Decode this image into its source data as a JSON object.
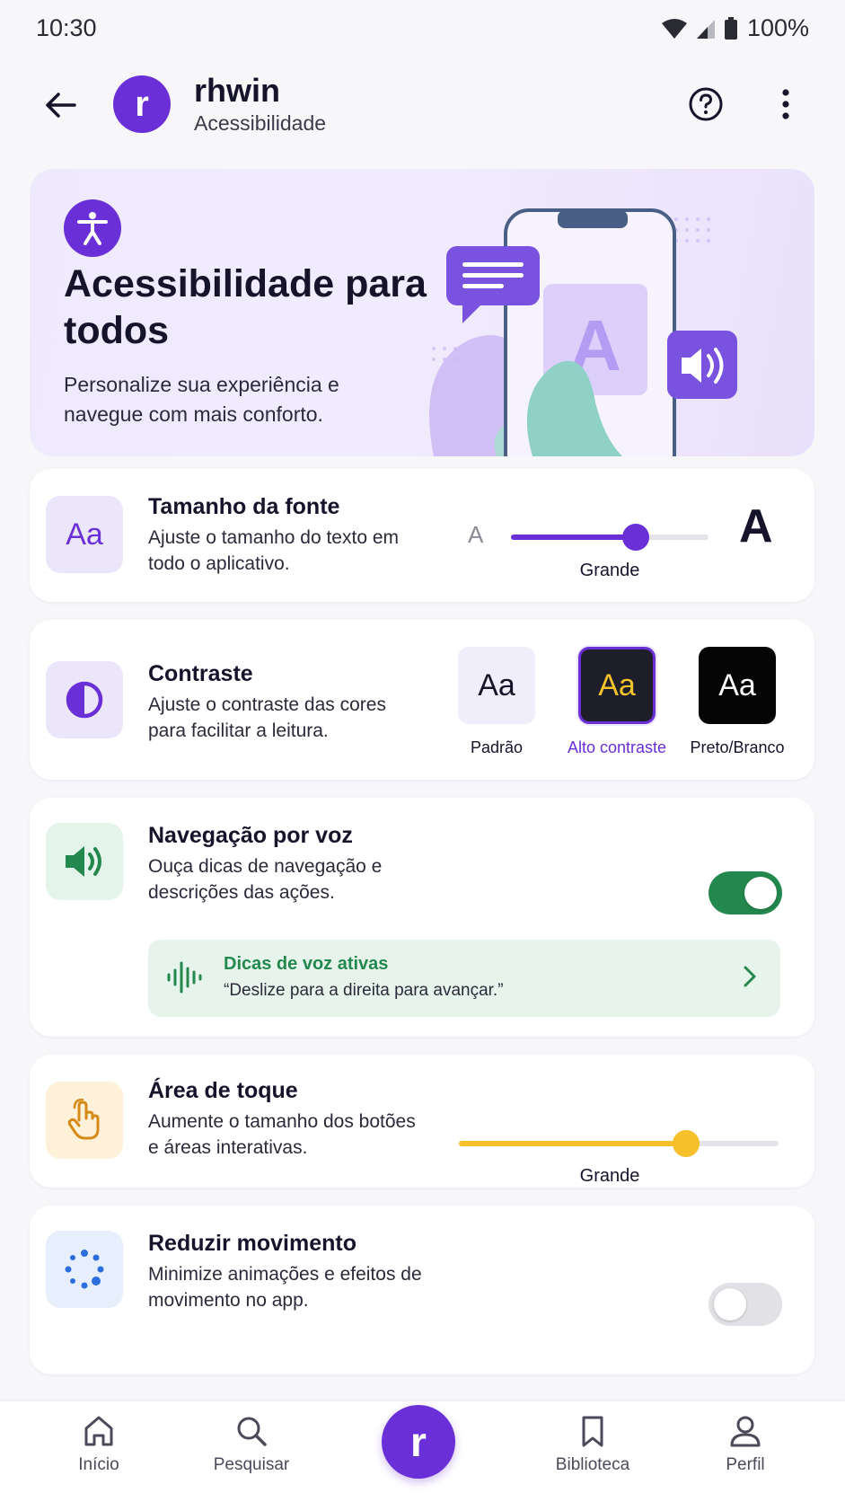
{
  "status_bar": {
    "time": "10:30",
    "battery": "100%"
  },
  "header": {
    "avatar_letter": "r",
    "title": "rhwin",
    "subtitle": "Acessibilidade"
  },
  "hero": {
    "title": "Acessibilidade para todos",
    "description": "Personalize sua experiência e navegue com mais conforto.",
    "illustration_letter": "A"
  },
  "font_size": {
    "title": "Tamanho da fonte",
    "description": "Ajuste o tamanho do texto em todo o aplicativo.",
    "icon_text": "Aa",
    "small_label": "A",
    "large_label": "A",
    "level": 0.63,
    "value_label": "Grande"
  },
  "contrast": {
    "title": "Contraste",
    "description": "Ajuste o contraste das cores para facilitar a leitura.",
    "options": [
      {
        "sample": "Aa",
        "label": "Padrão"
      },
      {
        "sample": "Aa",
        "label": "Alto contraste",
        "selected": true
      },
      {
        "sample": "Aa",
        "label": "Preto/Branco"
      }
    ]
  },
  "voice_nav": {
    "title": "Navegação por voz",
    "description": "Ouça dicas de navegação e descrições das ações.",
    "enabled": true,
    "tip_title": "Dicas de voz ativas",
    "tip_text": "“Deslize para a direita para avançar.”"
  },
  "touch_area": {
    "title": "Área de toque",
    "description": "Aumente o tamanho dos botões e áreas interativas.",
    "level": 0.71,
    "value_label": "Grande"
  },
  "reduce_motion": {
    "title": "Reduzir movimento",
    "description": "Minimize animações e efeitos de movimento no app.",
    "enabled": false
  },
  "bottom_nav": {
    "items": [
      {
        "label": "Início",
        "icon": "home-icon"
      },
      {
        "label": "Pesquisar",
        "icon": "search-icon"
      },
      {
        "label": "",
        "icon": "app-logo"
      },
      {
        "label": "Biblioteca",
        "icon": "bookmark-icon"
      },
      {
        "label": "Perfil",
        "icon": "profile-icon"
      }
    ],
    "center_letter": "r"
  },
  "colors": {
    "accent": "#6a2fd6",
    "toggle_on": "#23884d",
    "touch_slider": "#f5c02a"
  }
}
